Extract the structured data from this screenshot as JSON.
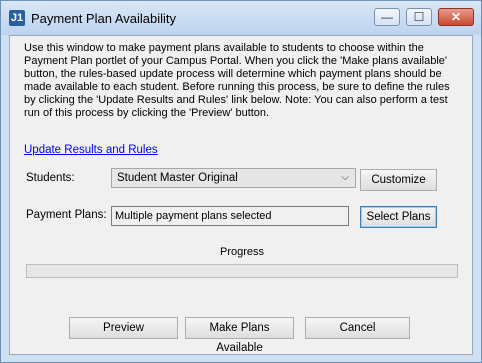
{
  "window": {
    "title": "Payment Plan Availability",
    "app_icon_text": "J1"
  },
  "description": "Use this window to make payment plans available to students to choose within the Payment Plan portlet of your Campus Portal.  When you click the 'Make plans available' button, the rules-based update process will determine which payment plans should be made available to each student.  Before running this process, be sure to define the rules by clicking the 'Update Results and Rules' link below.  Note: You can also perform a test run of this process by clicking the 'Preview' button.",
  "link_update": "Update Results and Rules",
  "students": {
    "label": "Students:",
    "selected": "Student Master Original",
    "customize_label": "Customize"
  },
  "payment_plans": {
    "label": "Payment Plans:",
    "value": "Multiple payment plans selected",
    "select_label": "Select Plans"
  },
  "progress": {
    "label": "Progress",
    "value": 0
  },
  "buttons": {
    "preview": "Preview",
    "make_available": "Make Plans Available",
    "cancel": "Cancel"
  }
}
